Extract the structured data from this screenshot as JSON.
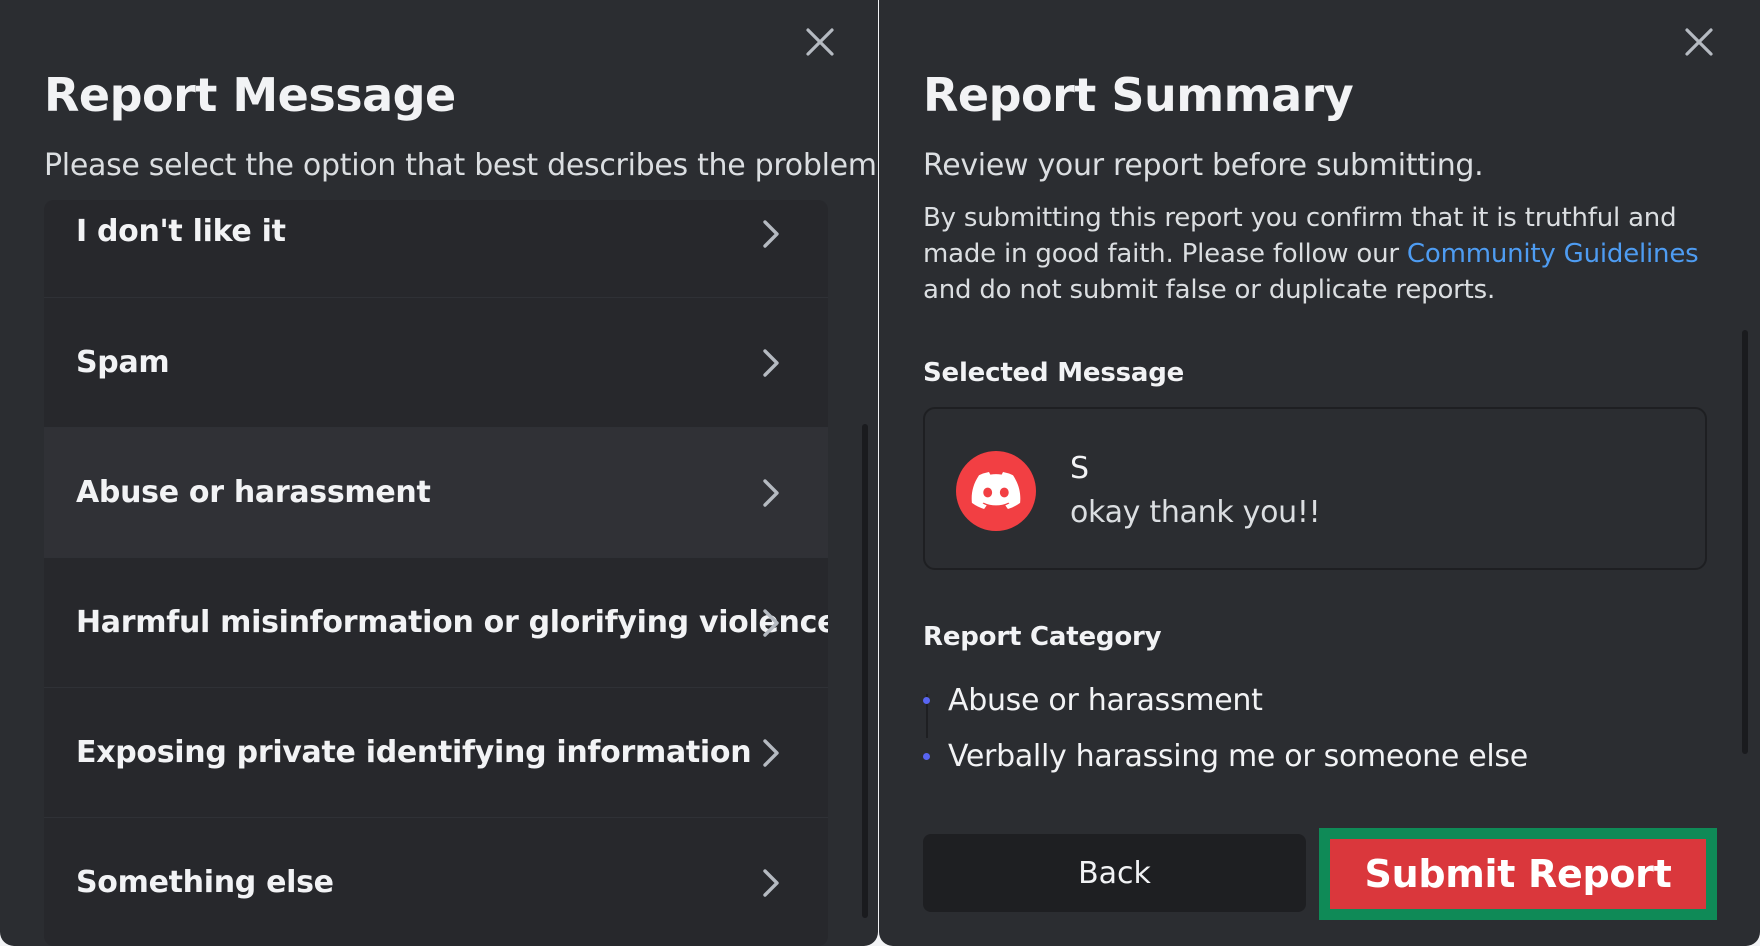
{
  "left": {
    "title": "Report Message",
    "subtitle": "Please select the option that best describes the problem.",
    "options": [
      {
        "label": "I don't like it"
      },
      {
        "label": "Spam"
      },
      {
        "label": "Abuse or harassment"
      },
      {
        "label": "Harmful misinformation or glorifying violence"
      },
      {
        "label": "Exposing private identifying information"
      },
      {
        "label": "Something else"
      }
    ]
  },
  "right": {
    "title": "Report Summary",
    "subtitle": "Review your report before submitting.",
    "description_before": "By submitting this report you confirm that it is truthful and made in good faith. Please follow our ",
    "description_link": "Community Guidelines",
    "description_after": " and do not submit false or duplicate reports.",
    "selected_message_label": "Selected Message",
    "message": {
      "username": "S",
      "text": "okay thank you!!"
    },
    "report_category_label": "Report Category",
    "categories": [
      "Abuse or harassment",
      "Verbally harassing me or someone else"
    ],
    "back_label": "Back",
    "submit_label": "Submit Report"
  },
  "icons": {
    "close": "close-icon",
    "chevron": "chevron-right-icon",
    "avatar": "discord-logo-icon"
  },
  "colors": {
    "panel_bg": "#2b2d31",
    "link": "#4e9cf2",
    "danger": "#da373c",
    "highlight_border": "#0f8a57",
    "avatar_bg": "#f23f43",
    "bullet": "#5865f2"
  }
}
